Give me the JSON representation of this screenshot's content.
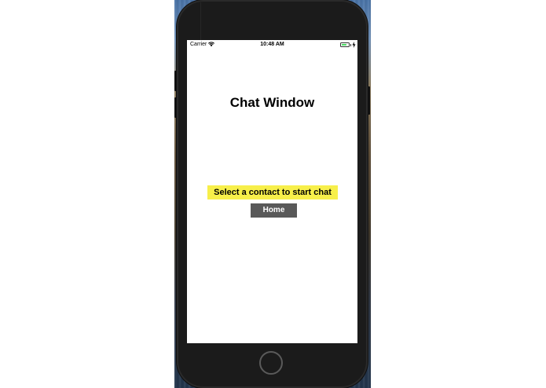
{
  "status_bar": {
    "carrier": "Carrier",
    "time": "10:48 AM",
    "battery_color": "#4cd964",
    "battery_level": 0.75
  },
  "screen": {
    "title": "Chat Window",
    "prompt": "Select a contact to start chat",
    "prompt_bg": "#f7ef4a",
    "home_button_label": "Home",
    "home_button_bg": "#595959"
  },
  "icons": {
    "wifi": "wifi-icon",
    "battery": "battery-icon",
    "charging": "charging-bolt-icon",
    "hardware_home": "hardware-home-button"
  }
}
